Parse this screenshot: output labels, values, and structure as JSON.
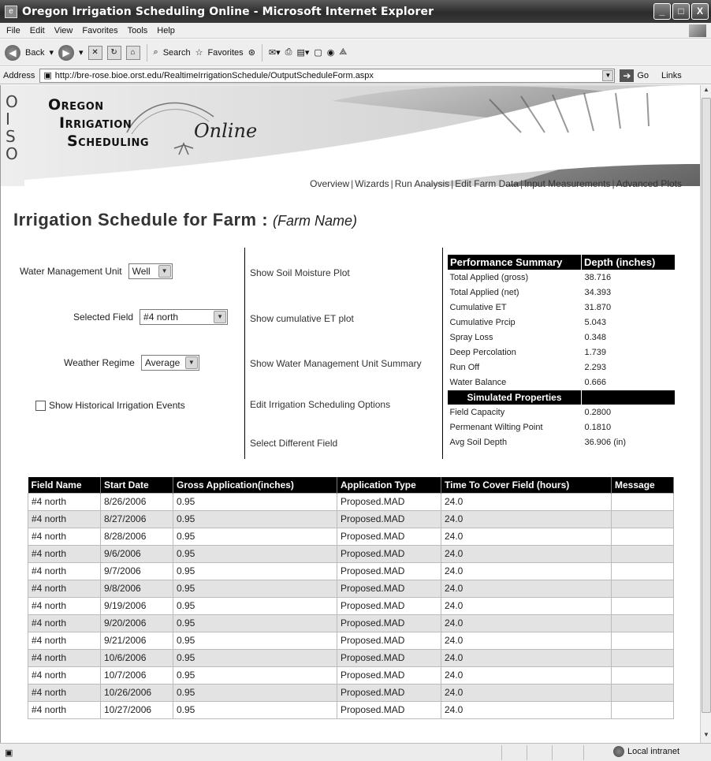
{
  "window": {
    "title": "Oregon Irrigation Scheduling Online - Microsoft Internet Explorer",
    "btn_min": "_",
    "btn_max": "□",
    "btn_close": "X"
  },
  "menu": [
    "File",
    "Edit",
    "View",
    "Favorites",
    "Tools",
    "Help"
  ],
  "toolbar": {
    "back": "Back",
    "search": "Search",
    "favorites": "Favorites"
  },
  "address": {
    "label": "Address",
    "url": "http://bre-rose.bioe.orst.edu/RealtimeIrrigationSchedule/OutputScheduleForm.aspx",
    "go": "Go",
    "links": "Links"
  },
  "banner": {
    "oiso": [
      "O",
      "I",
      "S",
      "O"
    ],
    "brand_lines": [
      "Oregon",
      "Irrigation",
      "Scheduling"
    ],
    "online": "Online"
  },
  "nav": [
    "Overview",
    "Wizards",
    "Run Analysis",
    "Edit Farm Data",
    "Input Measurements",
    "Advanced Plots"
  ],
  "page": {
    "title": "Irrigation Schedule for Farm :",
    "farm_name": "(Farm Name)"
  },
  "controls": {
    "wmu_label": "Water Management Unit",
    "wmu_value": "Well",
    "field_label": "Selected Field",
    "field_value": "#4 north",
    "weather_label": "Weather Regime",
    "weather_value": "Average",
    "historical_label": "Show Historical Irrigation Events"
  },
  "links": {
    "soil_moisture": "Show Soil Moisture Plot",
    "cumulative_et": "Show cumulative ET plot",
    "wmu_summary": "Show Water Management Unit Summary",
    "edit_options": "Edit Irrigation Scheduling Options",
    "select_field": "Select Different Field"
  },
  "summary": {
    "header": "Performance Summary",
    "header_unit": "Depth (inches)",
    "rows": [
      {
        "label": "Total Applied (gross)",
        "value": "38.716"
      },
      {
        "label": "Total Applied (net)",
        "value": "34.393"
      },
      {
        "label": "Cumulative ET",
        "value": "31.870"
      },
      {
        "label": "Cumulative Prcip",
        "value": "5.043"
      },
      {
        "label": "Spray Loss",
        "value": "0.348"
      },
      {
        "label": "Deep Percolation",
        "value": "1.739"
      },
      {
        "label": "Run Off",
        "value": "2.293"
      },
      {
        "label": "Water Balance",
        "value": "0.666"
      }
    ],
    "sim_header": "Simulated Properties",
    "sim_rows": [
      {
        "label": "Field Capacity",
        "value": "0.2800"
      },
      {
        "label": "Permenant Wilting Point",
        "value": "0.1810"
      },
      {
        "label": "Avg Soil Depth",
        "value": "36.906 (in)"
      }
    ]
  },
  "schedule": {
    "columns": [
      "Field Name",
      "Start Date",
      "Gross Application(inches)",
      "Application Type",
      "Time To Cover Field (hours)",
      "Message"
    ],
    "rows": [
      [
        "#4 north",
        "8/26/2006",
        "0.95",
        "Proposed.MAD",
        "24.0",
        ""
      ],
      [
        "#4 north",
        "8/27/2006",
        "0.95",
        "Proposed.MAD",
        "24.0",
        ""
      ],
      [
        "#4 north",
        "8/28/2006",
        "0.95",
        "Proposed.MAD",
        "24.0",
        ""
      ],
      [
        "#4 north",
        "9/6/2006",
        "0.95",
        "Proposed.MAD",
        "24.0",
        ""
      ],
      [
        "#4 north",
        "9/7/2006",
        "0.95",
        "Proposed.MAD",
        "24.0",
        ""
      ],
      [
        "#4 north",
        "9/8/2006",
        "0.95",
        "Proposed.MAD",
        "24.0",
        ""
      ],
      [
        "#4 north",
        "9/19/2006",
        "0.95",
        "Proposed.MAD",
        "24.0",
        ""
      ],
      [
        "#4 north",
        "9/20/2006",
        "0.95",
        "Proposed.MAD",
        "24.0",
        ""
      ],
      [
        "#4 north",
        "9/21/2006",
        "0.95",
        "Proposed.MAD",
        "24.0",
        ""
      ],
      [
        "#4 north",
        "10/6/2006",
        "0.95",
        "Proposed.MAD",
        "24.0",
        ""
      ],
      [
        "#4 north",
        "10/7/2006",
        "0.95",
        "Proposed.MAD",
        "24.0",
        ""
      ],
      [
        "#4 north",
        "10/26/2006",
        "0.95",
        "Proposed.MAD",
        "24.0",
        ""
      ],
      [
        "#4 north",
        "10/27/2006",
        "0.95",
        "Proposed.MAD",
        "24.0",
        ""
      ]
    ]
  },
  "status": {
    "zone": "Local intranet"
  }
}
